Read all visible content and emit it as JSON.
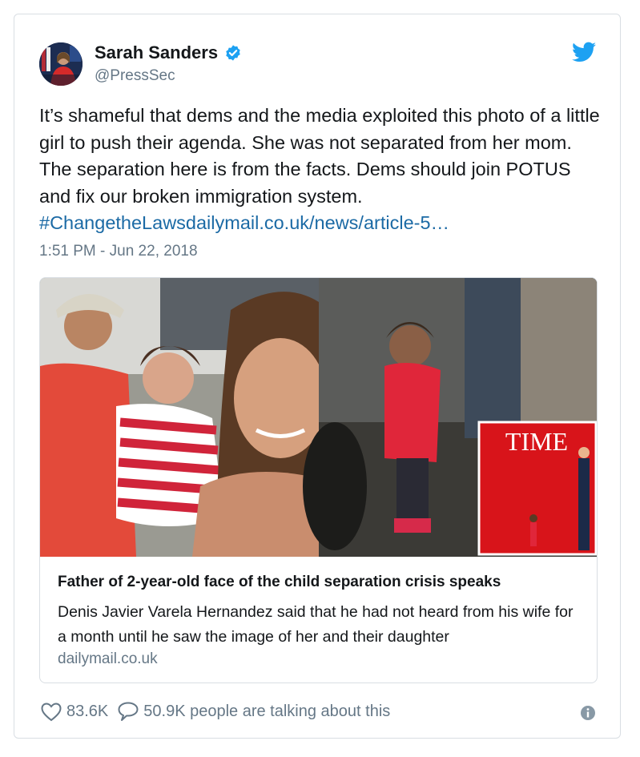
{
  "author": {
    "display_name": "Sarah Sanders",
    "handle": "@PressSec"
  },
  "tweet": {
    "text": "It’s shameful that dems and the media exploited this photo of a little girl to push their agenda. She was not separated from her mom. The separation here is from the facts. Dems should join POTUS and fix our broken immigration system.",
    "link_text": "#ChangetheLawsdailymail.co.uk/news/article-5…",
    "timestamp": "1:51 PM - Jun 22, 2018"
  },
  "link_card": {
    "title": "Father of 2-year-old face of the child separation crisis speaks",
    "description": "Denis Javier Varela Hernandez said that he had not heard from his wife for a month until he saw the image of her and their daughter",
    "domain": "dailymail.co.uk",
    "image_text": "TIME"
  },
  "footer": {
    "likes": "83.6K",
    "talking": "50.9K people are talking about this"
  },
  "colors": {
    "link": "#1b6aa5",
    "twitter_blue": "#1da1f2",
    "muted": "#657786"
  },
  "icons": [
    "verified-badge-icon",
    "twitter-bird-icon",
    "heart-icon",
    "speech-bubble-icon",
    "info-icon"
  ]
}
